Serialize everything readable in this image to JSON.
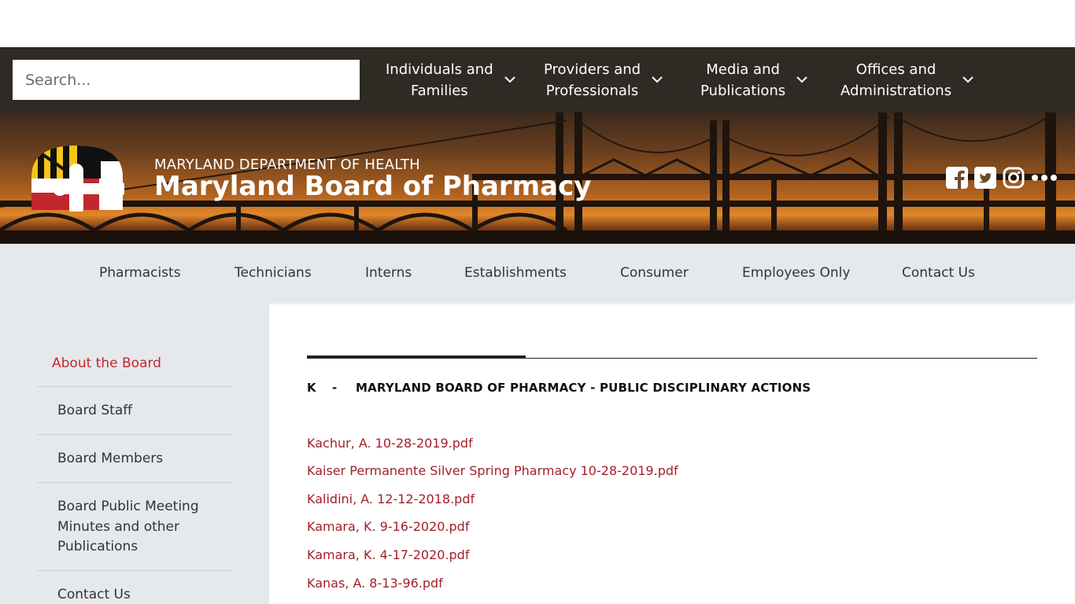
{
  "search": {
    "placeholder": "Search..."
  },
  "top_nav": [
    {
      "line1": "Individuals and",
      "line2": "Families"
    },
    {
      "line1": "Providers and",
      "line2": "Professionals"
    },
    {
      "line1": "Media and",
      "line2": "Publications"
    },
    {
      "line1": "Offices and",
      "line2": "Administrations"
    }
  ],
  "header": {
    "department": "MARYLAND DEPARTMENT OF HEALTH",
    "site_title": "Maryland Board of Pharmacy",
    "social_icons": [
      "facebook-icon",
      "twitter-icon",
      "instagram-icon",
      "more-icon"
    ]
  },
  "main_nav": [
    "Pharmacists",
    "Technicians",
    "Interns",
    "Establishments",
    "Consumer",
    "Employees Only",
    "Contact Us"
  ],
  "sidebar": {
    "active": "About the Board",
    "items": [
      "Board Staff",
      "Board Members",
      "Board Public Meeting Minutes and other Publications",
      "Contact Us"
    ]
  },
  "content": {
    "letter": "K",
    "dash": "-",
    "heading": "MARYLAND BOARD OF PHARMACY - PUBLIC DISCIPLINARY ACTIONS",
    "links": [
      "Kachur, A. 10-28-2019.pdf",
      "Kaiser Permanente Silver Spring Pharmacy 10-28-2019.pdf",
      "Kalidini, A. 12-12-2018.pdf",
      "Kamara, K. 9-16-2020.pdf",
      "Kamara, K. 4-17-2020.pdf",
      "Kanas, A. 8-13-96.pdf"
    ]
  },
  "colors": {
    "accent_red": "#a3202a",
    "active_red": "#c1272d",
    "utility_bar": "#2e2b25",
    "nav_bg": "#e6e9ec"
  }
}
